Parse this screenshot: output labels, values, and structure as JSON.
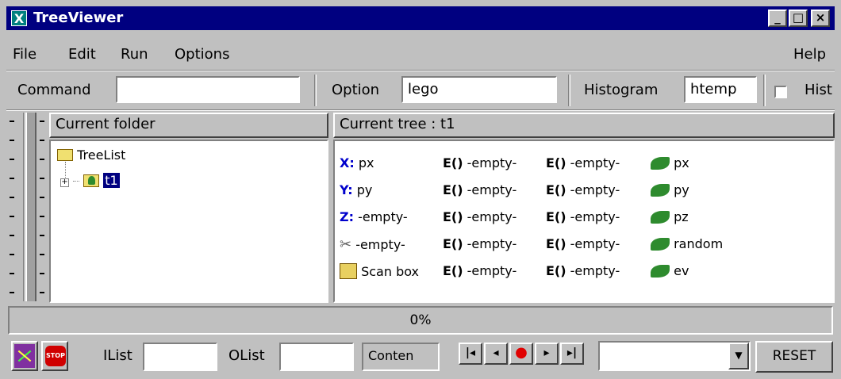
{
  "window": {
    "title": "TreeViewer",
    "app_icon": "X"
  },
  "menu": {
    "file": "File",
    "edit": "Edit",
    "run": "Run",
    "options": "Options",
    "help": "Help"
  },
  "toolbar": {
    "command_label": "Command",
    "command_value": "",
    "option_label": "Option",
    "option_value": "lego",
    "histogram_label": "Histogram",
    "histogram_value": "htemp",
    "hist_checkbox_label": "Hist"
  },
  "left_panel": {
    "header": "Current folder",
    "root_label": "TreeList",
    "child_label": "t1"
  },
  "right_panel": {
    "header": "Current tree : t1",
    "rows": [
      {
        "label": "X:",
        "value": "px",
        "e1": "E()",
        "v1": "-empty-",
        "e2": "E()",
        "v2": "-empty-",
        "leaf": "px"
      },
      {
        "label": "Y:",
        "value": "py",
        "e1": "E()",
        "v1": "-empty-",
        "e2": "E()",
        "v2": "-empty-",
        "leaf": "py"
      },
      {
        "label": "Z:",
        "value": "-empty-",
        "e1": "E()",
        "v1": "-empty-",
        "e2": "E()",
        "v2": "-empty-",
        "leaf": "pz"
      },
      {
        "label": "",
        "value": "-empty-",
        "e1": "E()",
        "v1": "-empty-",
        "e2": "E()",
        "v2": "-empty-",
        "leaf": "random"
      },
      {
        "label": "",
        "value": "Scan box",
        "e1": "E()",
        "v1": "-empty-",
        "e2": "E()",
        "v2": "-empty-",
        "leaf": "ev"
      }
    ]
  },
  "progress": {
    "text": "0%",
    "value": 0
  },
  "bottom": {
    "ilist_label": "IList",
    "ilist_value": "",
    "olist_label": "OList",
    "olist_value": "",
    "content_label": "Conten",
    "reset_label": "RESET",
    "combo_value": ""
  },
  "colors": {
    "titlebar": "#000080",
    "face": "#c0c0c0",
    "expr_blue": "#0000cc",
    "leaf_green": "#2e8b2e",
    "record_red": "#e00000"
  },
  "icons": [
    "x-app-icon",
    "minimize-icon",
    "maximize-icon",
    "close-icon",
    "folder-icon",
    "tree-folder-icon",
    "leaf-icon",
    "scissors-icon",
    "box-icon",
    "draw-icon",
    "stop-icon",
    "first-icon",
    "prev-icon",
    "record-icon",
    "next-icon",
    "last-icon",
    "dropdown-arrow-icon"
  ]
}
